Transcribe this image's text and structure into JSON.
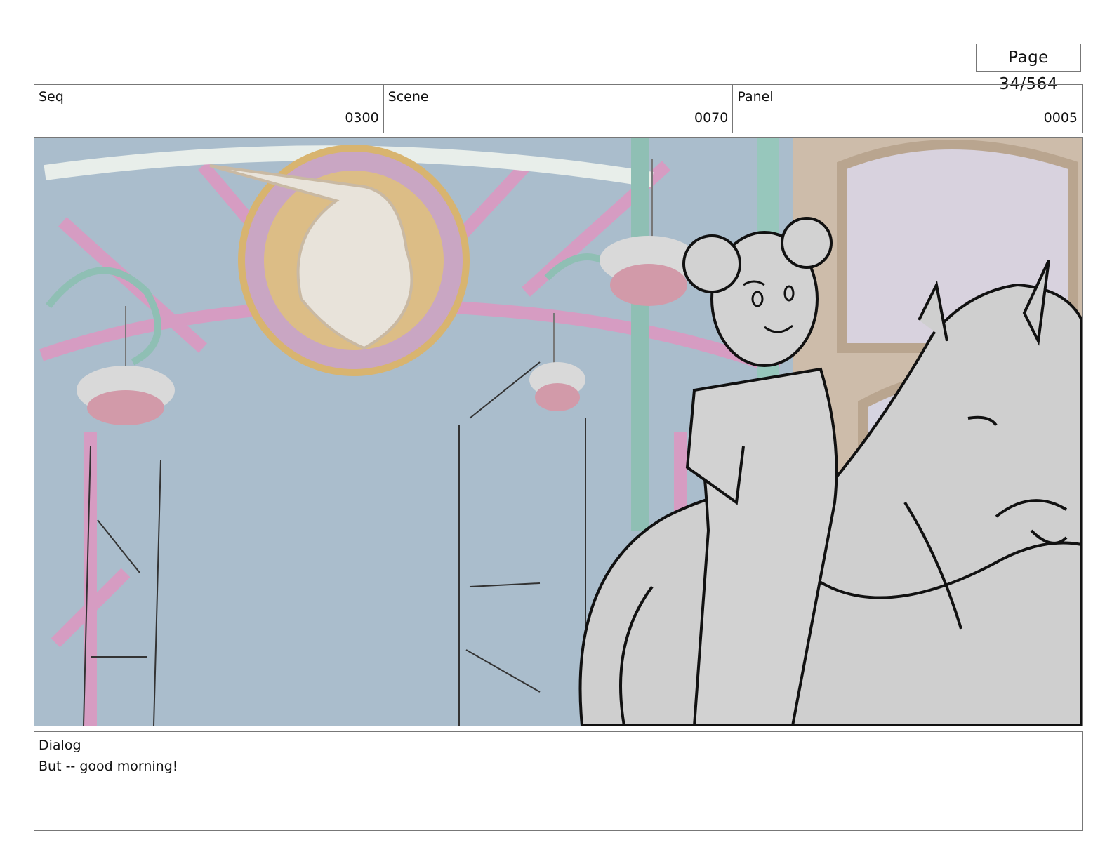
{
  "page": {
    "label": "Page",
    "number": "34/564"
  },
  "header": {
    "seq": {
      "label": "Seq",
      "value": "0300"
    },
    "scene": {
      "label": "Scene",
      "value": "0070"
    },
    "panel": {
      "label": "Panel",
      "value": "0005"
    }
  },
  "dialog": {
    "label": "Dialog",
    "text": "But -- good morning!"
  },
  "colors": {
    "background_blue": "#a8bccb",
    "frame_pink": "#d79ac0",
    "frame_teal": "#8fbfb4",
    "wall_tan": "#c7b49e",
    "sketch_gray": "#cfcfcf",
    "line_black": "#111111"
  }
}
